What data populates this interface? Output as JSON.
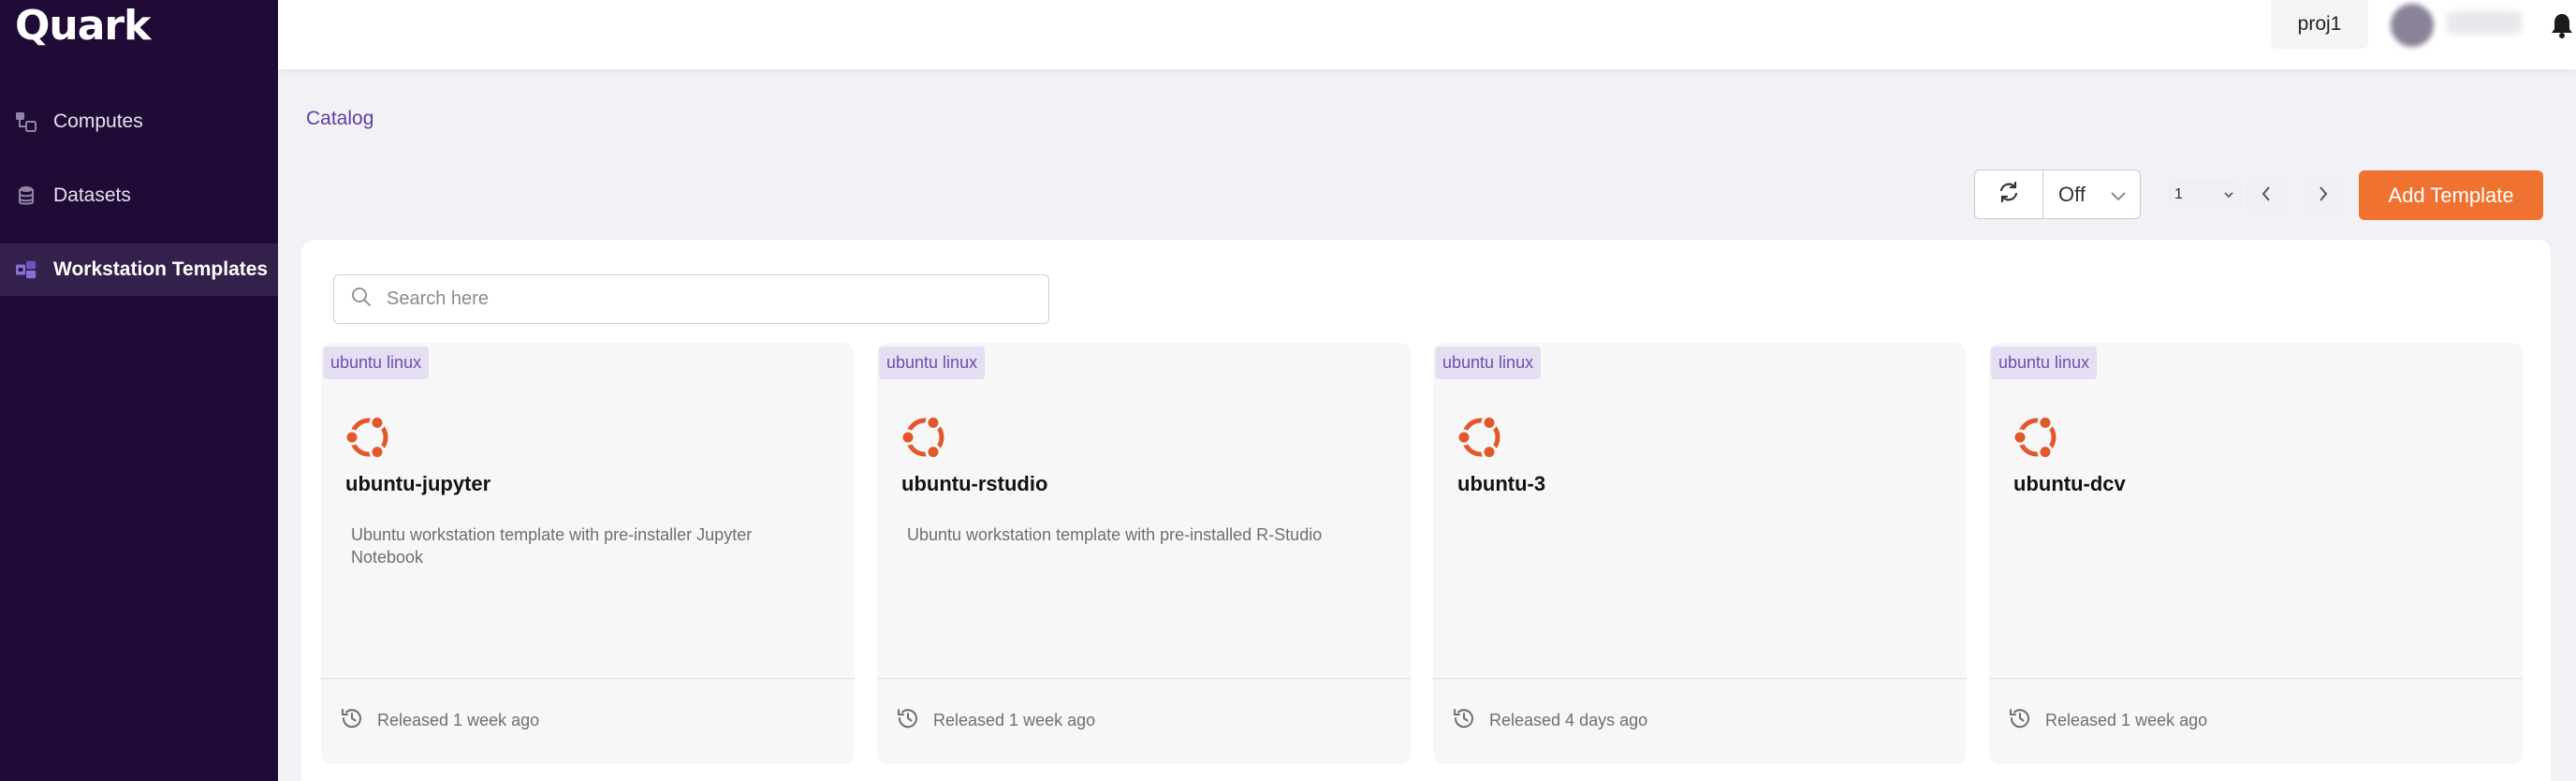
{
  "app": {
    "logo": "Quark"
  },
  "sidebar": {
    "items": [
      {
        "label": "Computes",
        "icon": "computes-icon",
        "active": false
      },
      {
        "label": "Datasets",
        "icon": "database-icon",
        "active": false
      },
      {
        "label": "Workstation Templates",
        "icon": "templates-icon",
        "active": true
      }
    ]
  },
  "header": {
    "project": "proj1",
    "bell_icon": "bell-icon"
  },
  "breadcrumb": "Catalog",
  "toolbar": {
    "refresh_icon": "refresh-icon",
    "interval_value": "Off",
    "page_value": "1",
    "add_label": "Add Template",
    "accent_color": "#f07231"
  },
  "search": {
    "placeholder": "Search here",
    "value": ""
  },
  "cards": [
    {
      "tag": "ubuntu linux",
      "name": "ubuntu-jupyter",
      "description": "Ubuntu workstation template with pre-installer Jupyter Notebook",
      "released": "Released 1 week ago"
    },
    {
      "tag": "ubuntu linux",
      "name": "ubuntu-rstudio",
      "description": "Ubuntu workstation template with pre-installed R-Studio",
      "released": "Released 1 week ago"
    },
    {
      "tag": "ubuntu linux",
      "name": "ubuntu-3",
      "description": "",
      "released": "Released 4 days ago"
    },
    {
      "tag": "ubuntu linux",
      "name": "ubuntu-dcv",
      "description": "",
      "released": "Released 1 week ago"
    }
  ]
}
